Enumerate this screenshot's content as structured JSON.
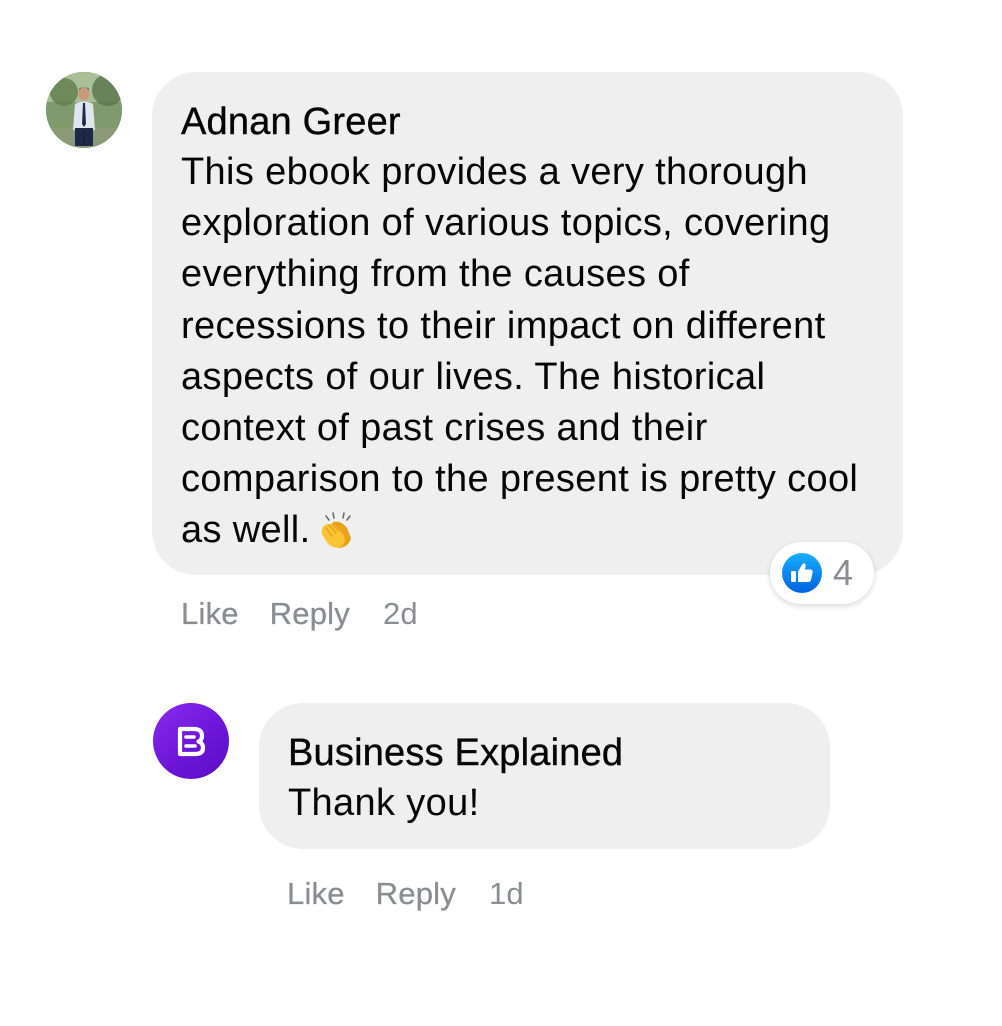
{
  "comments": [
    {
      "author": "Adnan Greer",
      "text": "This ebook provides a very thorough exploration of various topics, covering everything from the causes of recessions to their impact on different aspects of our lives. The historical context of past crises and their comparison to the present is pretty cool as well.",
      "emoji": "clapping-hands",
      "reaction": {
        "type": "like",
        "count": "4"
      },
      "actions": {
        "like": "Like",
        "reply": "Reply",
        "time": "2d"
      }
    },
    {
      "author": "Business Explained",
      "text": "Thank you!",
      "actions": {
        "like": "Like",
        "reply": "Reply",
        "time": "1d"
      }
    }
  ],
  "colors": {
    "bubble": "#efefef",
    "meta_text": "#8a8d91",
    "like_blue": "#1877f2",
    "brand_purple": "#7a1fe6"
  }
}
